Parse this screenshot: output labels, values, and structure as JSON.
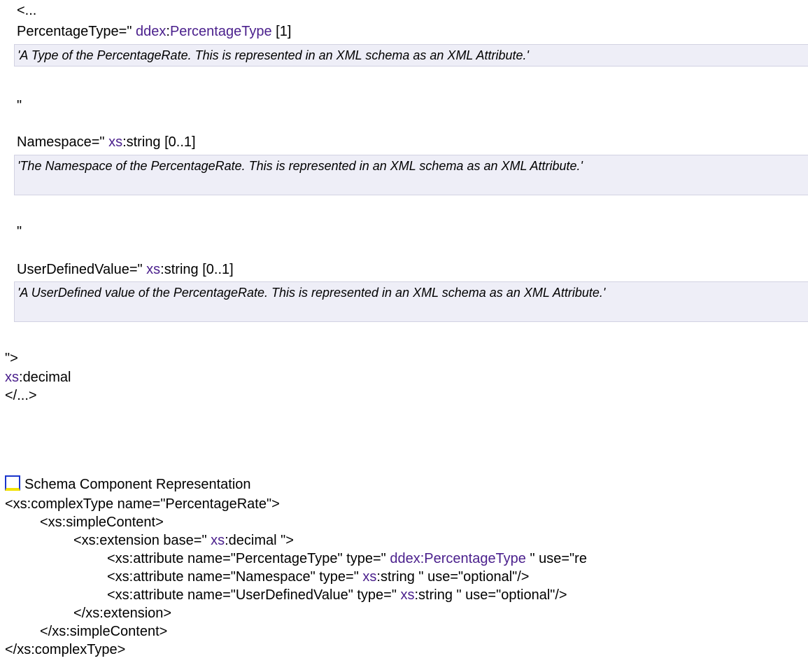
{
  "head_open": "<...",
  "attributes": [
    {
      "name": "PercentageType=\"",
      "ns": "ddex",
      "type": "PercentageType",
      "card": "[1]",
      "desc": "'A Type of the PercentageRate. This is represented in an XML schema as an XML Attribute.'",
      "after": "\""
    },
    {
      "name": "Namespace=\"",
      "ns": "xs",
      "type": "string",
      "card": "[0..1]",
      "desc": "'The Namespace of the PercentageRate. This is represented in an XML schema as an XML Attribute.'",
      "after": "\""
    },
    {
      "name": "UserDefinedValue=\"",
      "ns": "xs",
      "type": "string",
      "card": "[0..1]",
      "desc": "'A UserDefined value of the PercentageRate. This is represented in an XML schema as an XML Attribute.'"
    }
  ],
  "close_attr": "\">",
  "content": {
    "ns": "xs",
    "type": "decimal"
  },
  "close_tag": "</...>",
  "schema_section": {
    "title": "Schema Component Representation"
  },
  "code": {
    "l1": "<xs:complexType name=\"PercentageRate\">",
    "l2": "<xs:simpleContent>",
    "l3_pre": "<xs:extension base=\" ",
    "l3_ns": "xs",
    "l3_post": ":decimal \">",
    "l4_pre": "<xs:attribute name=\"PercentageType\" type=\" ",
    "l4_ns": "ddex",
    "l4_sep": ":",
    "l4_type": "PercentageType",
    "l4_post": " \" use=\"re",
    "l5_pre": "<xs:attribute name=\"Namespace\" type=\" ",
    "l5_ns": "xs",
    "l5_post": ":string \" use=\"optional\"/>",
    "l6_pre": "<xs:attribute name=\"UserDefinedValue\" type=\" ",
    "l6_ns": "xs",
    "l6_post": ":string \" use=\"optional\"/>",
    "l7": "</xs:extension>",
    "l8": "</xs:simpleContent>",
    "l9": "</xs:complexType>"
  },
  "colors": {
    "link": "#4a1f8c",
    "desc_bg": "#eeeef7",
    "toggle_border": "#1a35cc",
    "toggle_accent": "#f2e200"
  }
}
